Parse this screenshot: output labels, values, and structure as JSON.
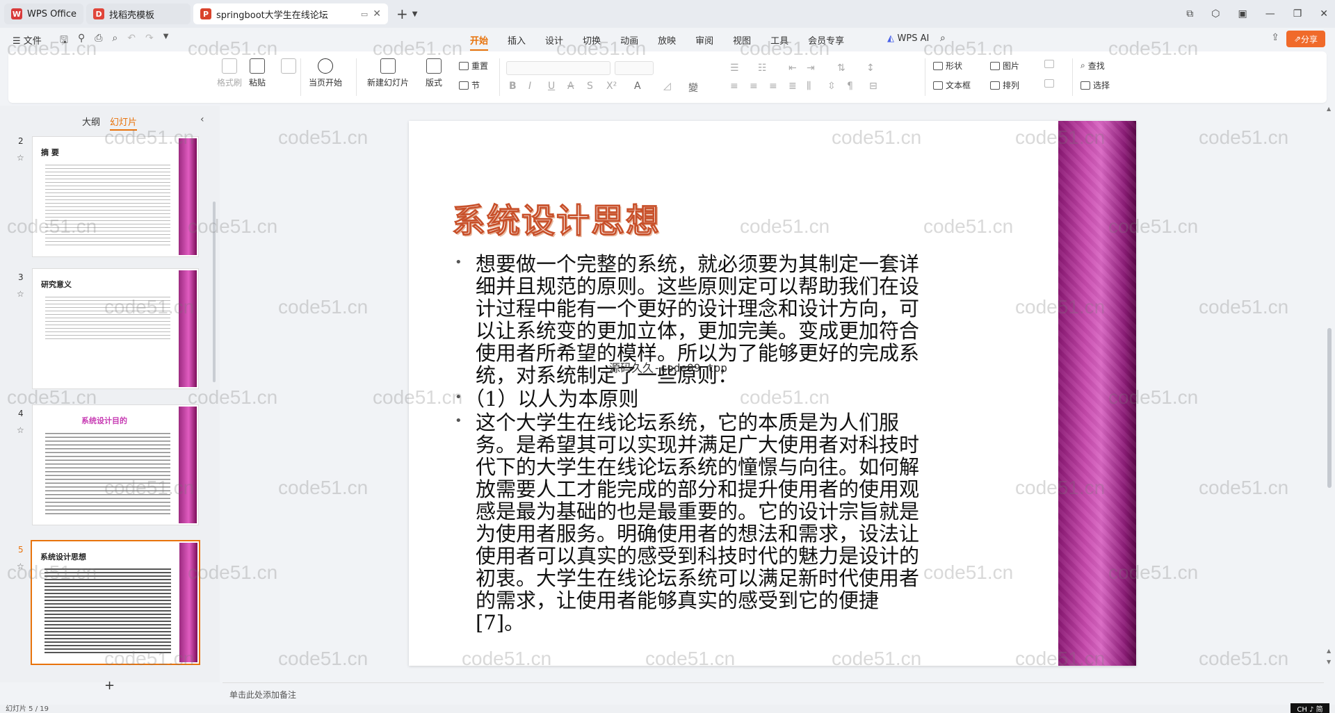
{
  "tabs": [
    {
      "label": "WPS Office",
      "logo": "W",
      "color": "#d83b3b"
    },
    {
      "label": "找稻壳模板",
      "logo": "D",
      "color": "#e0453a"
    },
    {
      "label": "springboot大学生在线论坛",
      "logo": "P",
      "color": "#d9432c"
    }
  ],
  "menu": {
    "file": "☰ 文件",
    "ribbon_tabs": [
      "开始",
      "插入",
      "设计",
      "切换",
      "动画",
      "放映",
      "审阅",
      "视图",
      "工具",
      "会员专享"
    ],
    "ai": "WPS AI",
    "share": "分享"
  },
  "ribbon": {
    "format_painter": "格式刷",
    "paste": "粘贴",
    "play_current": "当页开始",
    "new_slide": "新建幻灯片",
    "layout": "版式",
    "reset": "重置",
    "section": "节",
    "shape": "形状",
    "picture": "图片",
    "textbox": "文本框",
    "arrange": "排列",
    "find": "查找",
    "select": "选择"
  },
  "panel": {
    "outline_tab": "大纲",
    "slides_tab": "幻灯片",
    "slides": [
      {
        "num": "2",
        "title": "摘 要"
      },
      {
        "num": "3",
        "title": "研究意义"
      },
      {
        "num": "4",
        "title": "系统设计目的"
      },
      {
        "num": "5",
        "title": "系统设计思想"
      }
    ],
    "add_label": "+"
  },
  "slide": {
    "title": "系统设计思想",
    "bullets": [
      "想要做一个完整的系统，就必须要为其制定一套详细并且规范的原则。这些原则定可以帮助我们在设计过程中能有一个更好的设计理念和设计方向，可以让系统变的更加立体，更加完美。变成更加符合使用者所希望的模样。所以为了能够更好的完成系统，对系统制定了一些原则：",
      "（1）以人为本原则",
      "这个大学生在线论坛系统，它的本质是为人们服务。是希望其可以实现并满足广大使用者对科技时代下的大学生在线论坛系统的憧憬与向往。如何解放需要人工才能完成的部分和提升使用者的使用观感是最为基础的也是最重要的。它的设计宗旨就是为使用者服务。明确使用者的想法和需求，设法让使用者可以真实的感受到科技时代的魅力是设计的初衷。大学生在线论坛系统可以满足新时代使用者的需求，让使用者能够真实的感受到它的便捷[7]。"
    ],
    "source_note": "源码久久-code99.top"
  },
  "notes_placeholder": "单击此处添加备注",
  "status": {
    "left": "幻灯片 5 / 19",
    "lang": "CH ♪ 简"
  },
  "watermark": "code51.cn",
  "colors": {
    "accent": "#e8730c",
    "band": "#b8399c",
    "share": "#f06a2a"
  }
}
